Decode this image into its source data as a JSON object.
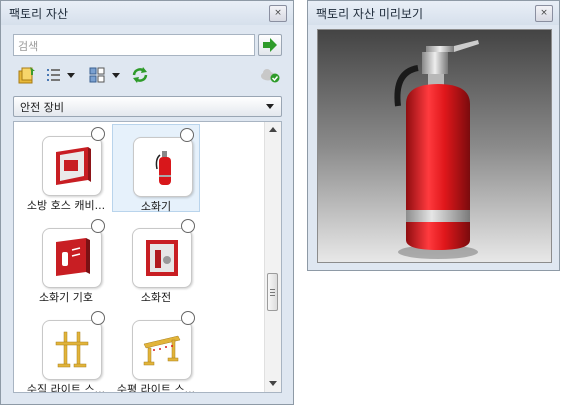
{
  "library_panel": {
    "title": "팩토리 자산",
    "close_glyph": "×",
    "search": {
      "placeholder": "검색"
    },
    "category": {
      "selected": "안전 장비"
    },
    "items": [
      {
        "label": "소방 호스 캐비...",
        "selected": false,
        "icon": "fire-hose-cabinet-icon"
      },
      {
        "label": "소화기",
        "selected": true,
        "icon": "fire-extinguisher-icon"
      },
      {
        "label": "소화기 기호",
        "selected": false,
        "icon": "fire-extinguisher-sign-icon"
      },
      {
        "label": "소화전",
        "selected": false,
        "icon": "fire-hydrant-cabinet-icon"
      },
      {
        "label": "수직 라이트 스...",
        "selected": false,
        "icon": "vertical-light-stand-icon"
      },
      {
        "label": "수평 라이트 스...",
        "selected": false,
        "icon": "horizontal-light-stand-icon"
      }
    ]
  },
  "preview_panel": {
    "title": "팩토리 자산 미리보기",
    "close_glyph": "×",
    "model": "fire-extinguisher-3d"
  },
  "colors": {
    "panel_bg": "#dfe7f1",
    "extinguisher_red": "#e0171b",
    "go_arrow_green": "#2e9b2a",
    "selection_bg": "#e6f1fb"
  }
}
